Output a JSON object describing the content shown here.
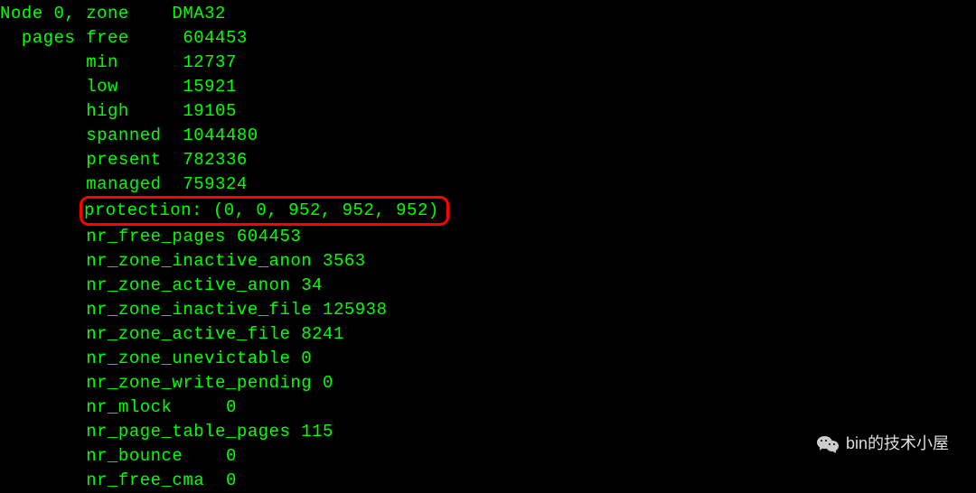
{
  "terminal": {
    "lines": [
      "Node 0, zone    DMA32",
      "  pages free     604453",
      "        min      12737",
      "        low      15921",
      "        high     19105",
      "        spanned  1044480",
      "        present  782336",
      "        managed  759324"
    ],
    "highlighted_line": "protection: (0, 0, 952, 952, 952)",
    "lines_after": [
      "        nr_free_pages 604453",
      "        nr_zone_inactive_anon 3563",
      "        nr_zone_active_anon 34",
      "        nr_zone_inactive_file 125938",
      "        nr_zone_active_file 8241",
      "        nr_zone_unevictable 0",
      "        nr_zone_write_pending 0",
      "        nr_mlock     0",
      "        nr_page_table_pages 115",
      "        nr_bounce    0",
      "        nr_free_cma  0"
    ]
  },
  "watermark": {
    "text": "bin的技术小屋"
  }
}
